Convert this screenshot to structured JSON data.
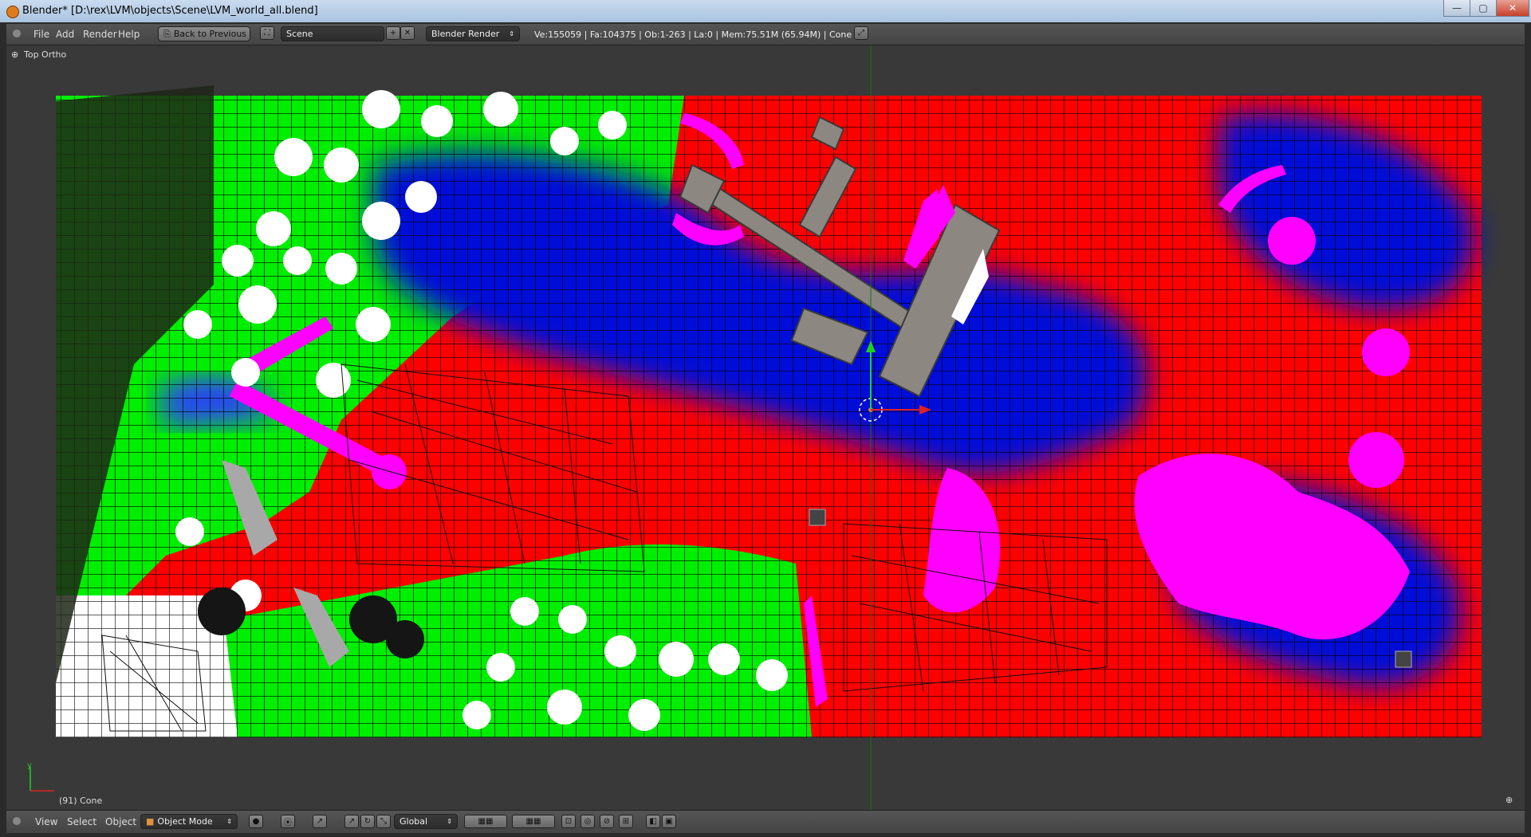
{
  "window": {
    "title": "Blender* [D:\\rex\\LVM\\objects\\Scene\\LVM_world_all.blend]",
    "minimize": "—",
    "maximize": "▢",
    "close": "✕"
  },
  "info_header": {
    "menus": [
      "File",
      "Add",
      "Render",
      "Help"
    ],
    "back_button": "Back to Previous",
    "scene_name": "Scene",
    "render_engine": "Blender Render",
    "stats": "Ve:155059 | Fa:104375 | Ob:1-263 | La:0 | Mem:75.51M (65.94M) | Cone"
  },
  "viewport": {
    "view_name": "Top Ortho",
    "object_label": "(91) Cone",
    "axis_y": "y",
    "colors": {
      "background": "#393939",
      "grass": "#00ee00",
      "water": "#0010d8",
      "red": "#ff0000",
      "magenta": "#ff00ff",
      "white": "#ffffff"
    }
  },
  "bottom_header": {
    "menus": [
      "View",
      "Select",
      "Object"
    ],
    "mode": "Object Mode",
    "orientation": "Global"
  }
}
